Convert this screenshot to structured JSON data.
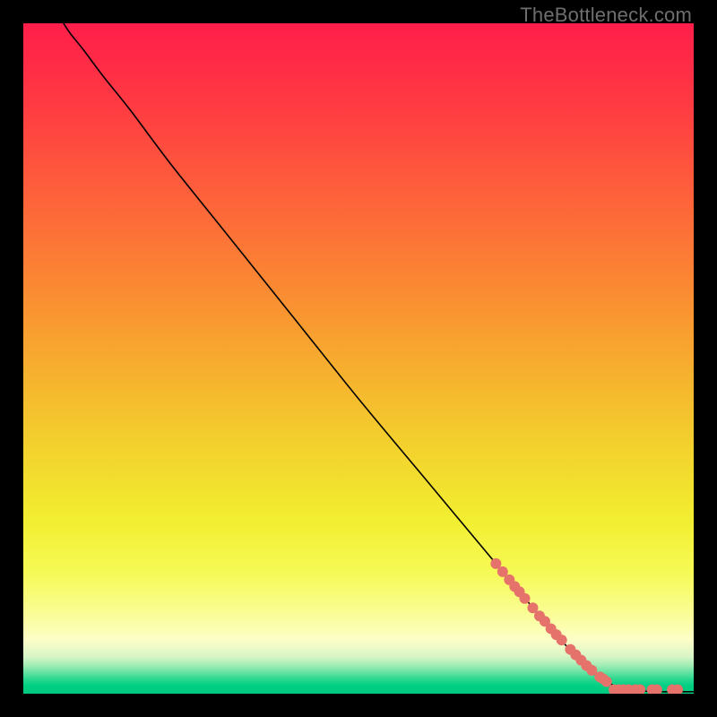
{
  "watermark": "TheBottleneck.com",
  "chart_data": {
    "type": "line",
    "title": "",
    "xlabel": "",
    "ylabel": "",
    "xlim": [
      0,
      100
    ],
    "ylim": [
      0,
      100
    ],
    "grid": false,
    "series": [
      {
        "name": "curve",
        "kind": "line",
        "color": "#000000",
        "points": [
          {
            "x": 6,
            "y": 100
          },
          {
            "x": 7,
            "y": 98.5
          },
          {
            "x": 9,
            "y": 96
          },
          {
            "x": 12,
            "y": 92
          },
          {
            "x": 16,
            "y": 87
          },
          {
            "x": 22,
            "y": 79
          },
          {
            "x": 30,
            "y": 69
          },
          {
            "x": 40,
            "y": 56.5
          },
          {
            "x": 50,
            "y": 44
          },
          {
            "x": 60,
            "y": 32
          },
          {
            "x": 70,
            "y": 20
          },
          {
            "x": 78,
            "y": 10.5
          },
          {
            "x": 84,
            "y": 4
          },
          {
            "x": 87,
            "y": 1.8
          },
          {
            "x": 90,
            "y": 0.6
          },
          {
            "x": 95,
            "y": 0.3
          },
          {
            "x": 100,
            "y": 0.3
          }
        ]
      },
      {
        "name": "markers",
        "kind": "scatter",
        "color": "#E5736B",
        "size": 12,
        "points": [
          {
            "x": 70.5,
            "y": 19.4
          },
          {
            "x": 71.5,
            "y": 18.2
          },
          {
            "x": 72.5,
            "y": 17.0
          },
          {
            "x": 73.3,
            "y": 16.0
          },
          {
            "x": 74.0,
            "y": 15.2
          },
          {
            "x": 74.8,
            "y": 14.2
          },
          {
            "x": 76.0,
            "y": 12.8
          },
          {
            "x": 77.0,
            "y": 11.6
          },
          {
            "x": 77.8,
            "y": 10.8
          },
          {
            "x": 78.7,
            "y": 9.7
          },
          {
            "x": 79.5,
            "y": 8.8
          },
          {
            "x": 80.3,
            "y": 8.0
          },
          {
            "x": 81.6,
            "y": 6.6
          },
          {
            "x": 82.4,
            "y": 5.8
          },
          {
            "x": 83.2,
            "y": 5.0
          },
          {
            "x": 84.0,
            "y": 4.2
          },
          {
            "x": 84.8,
            "y": 3.5
          },
          {
            "x": 86.0,
            "y": 2.5
          },
          {
            "x": 86.5,
            "y": 2.2
          },
          {
            "x": 87.0,
            "y": 1.8
          },
          {
            "x": 88.1,
            "y": 0.6
          },
          {
            "x": 88.8,
            "y": 0.6
          },
          {
            "x": 89.5,
            "y": 0.6
          },
          {
            "x": 90.3,
            "y": 0.6
          },
          {
            "x": 91.3,
            "y": 0.6
          },
          {
            "x": 92.0,
            "y": 0.6
          },
          {
            "x": 93.8,
            "y": 0.6
          },
          {
            "x": 94.5,
            "y": 0.6
          },
          {
            "x": 96.8,
            "y": 0.6
          },
          {
            "x": 97.6,
            "y": 0.6
          }
        ]
      }
    ],
    "background_gradient": {
      "type": "vertical",
      "stops": [
        {
          "pos": 0.0,
          "color": "#FF1E4A"
        },
        {
          "pos": 0.12,
          "color": "#FF3A42"
        },
        {
          "pos": 0.25,
          "color": "#FE5F3B"
        },
        {
          "pos": 0.38,
          "color": "#FB8533"
        },
        {
          "pos": 0.5,
          "color": "#F7AA2F"
        },
        {
          "pos": 0.62,
          "color": "#F3CE2D"
        },
        {
          "pos": 0.74,
          "color": "#F2EE30"
        },
        {
          "pos": 0.82,
          "color": "#F6FA56"
        },
        {
          "pos": 0.88,
          "color": "#FAFD95"
        },
        {
          "pos": 0.92,
          "color": "#FDFEC8"
        },
        {
          "pos": 0.945,
          "color": "#D7F5C6"
        },
        {
          "pos": 0.958,
          "color": "#A0ECB4"
        },
        {
          "pos": 0.968,
          "color": "#66E2A2"
        },
        {
          "pos": 0.978,
          "color": "#2BD890"
        },
        {
          "pos": 0.988,
          "color": "#00CF84"
        },
        {
          "pos": 1.0,
          "color": "#00C97F"
        }
      ]
    }
  }
}
